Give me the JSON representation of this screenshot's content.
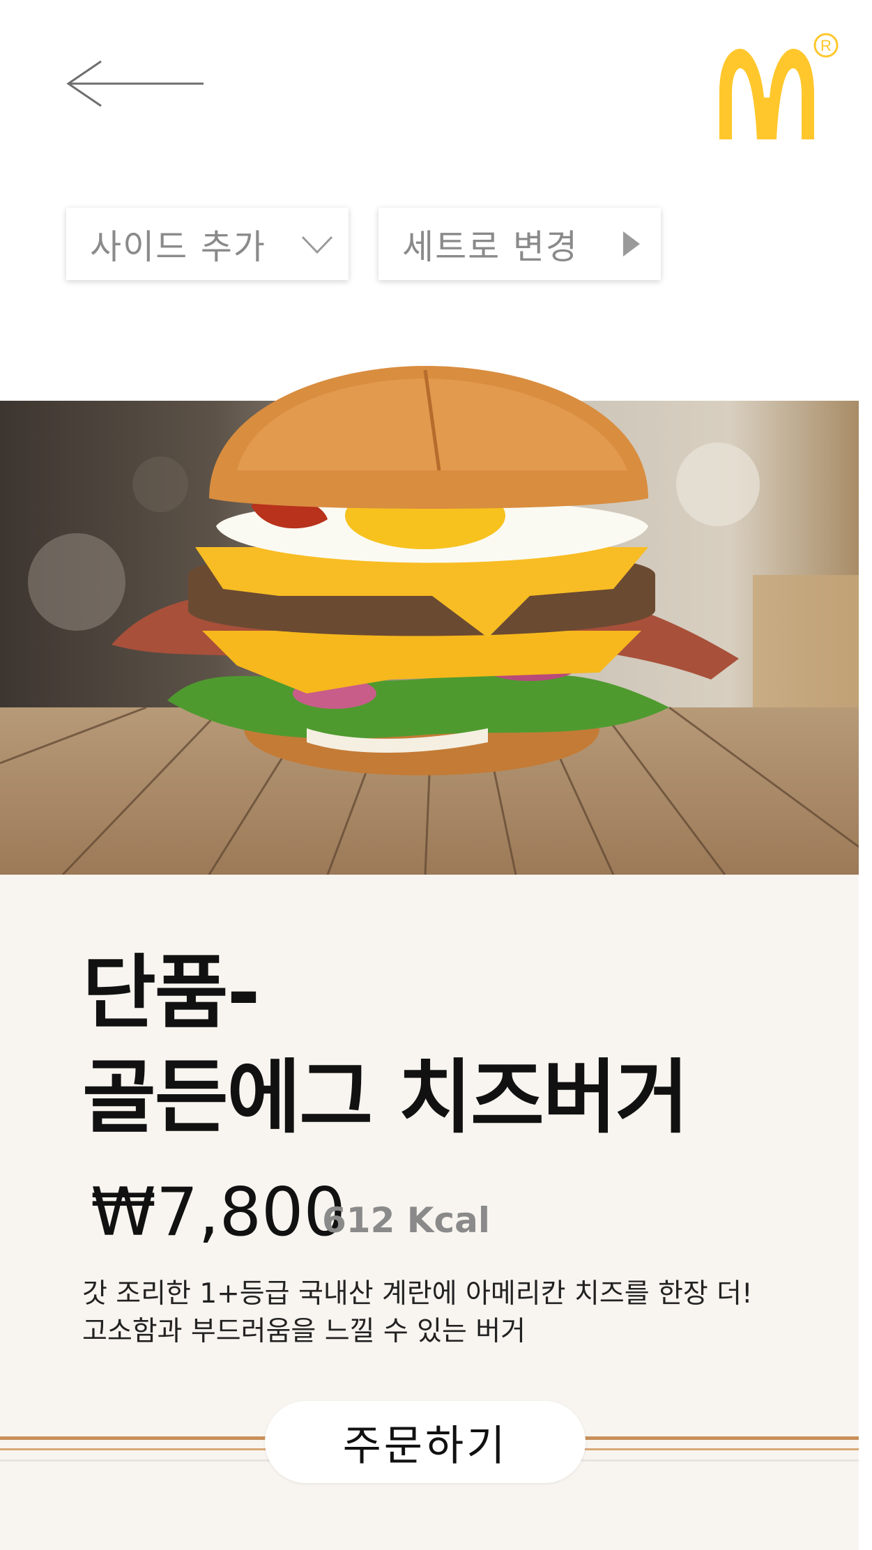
{
  "header": {
    "back_icon": "arrow-left-icon",
    "logo": "golden-arches-logo",
    "registered_mark": "R",
    "brand_color": "#ffc72c"
  },
  "options": {
    "side_add": {
      "label": "사이드 추가",
      "icon": "chevron-down-icon"
    },
    "set_change": {
      "label": "세트로 변경",
      "icon": "triangle-right-icon"
    }
  },
  "hero": {
    "image": "burger-photo",
    "background": "wood-table-blurred-restaurant"
  },
  "product": {
    "title_line1": "단품-",
    "title_line2": "골든에그 치즈버거",
    "price": "₩7,800",
    "kcal": "612 Kcal",
    "description_line1": "갓 조리한 1+등급 국내산 계란에 아메리칸 치즈를 한장 더!",
    "description_line2": "고소함과 부드러움을 느낄 수 있는 버거"
  },
  "order": {
    "label": "주문하기"
  },
  "colors": {
    "panel_bg": "#f8f5f0",
    "stripe": "#c9905a",
    "muted_text": "#8a8a8a"
  }
}
